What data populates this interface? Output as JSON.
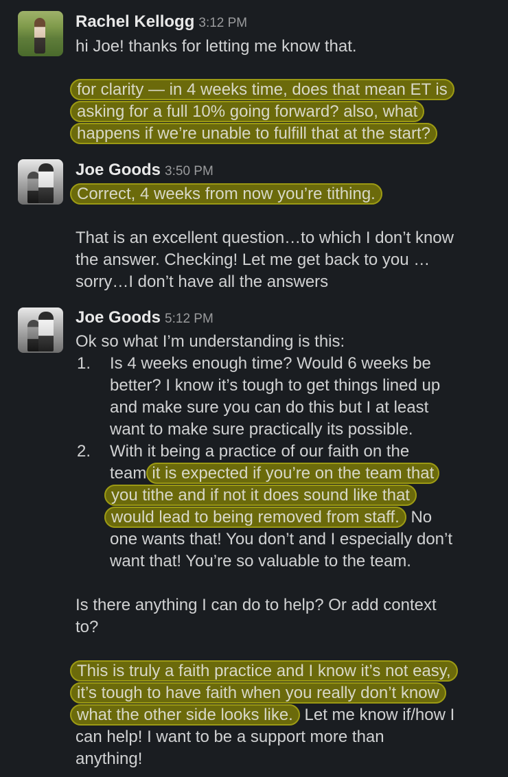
{
  "messages": [
    {
      "sender": "Rachel Kellogg",
      "time": "3:12 PM",
      "line1": "hi Joe! thanks for letting me know that.",
      "hl1": "for clarity — in 4 weeks time, does that mean ET is",
      "hl2": "asking for a full 10% going forward? also, what",
      "hl3": "happens if we’re unable to fulfill that at the start?"
    },
    {
      "sender": "Joe Goods",
      "time": "3:50 PM",
      "hl1": "Correct, 4 weeks from now you’re tithing.",
      "line1": "That is an excellent question…to which I don’t know",
      "line2": "the answer. Checking! Let me get back to you …",
      "line3": "sorry…I don’t have all the answers"
    },
    {
      "sender": "Joe Goods",
      "time": "5:12 PM",
      "intro": "Ok so what I’m understanding is this:",
      "item1": {
        "num": "1.",
        "l1": "Is 4 weeks enough time? Would 6 weeks be",
        "l2": "better? I know it’s tough to get things lined up",
        "l3": "and make sure you can do this but I at least",
        "l4": "want to make sure practically its possible."
      },
      "item2": {
        "num": "2.",
        "l1": "With it being a practice of our faith on the",
        "l2a": "team",
        "l2hl": "it is expected if you’re on the team that",
        "l3hl": "you tithe and if not it does sound like that",
        "l4hl": "would lead to being removed from staff.",
        "l4b": " No",
        "l5": "one wants that! You don’t and I especially don’t",
        "l6": "want that! You’re so valuable to the team."
      },
      "p2l1": "Is there anything I can do to help? Or add context",
      "p2l2": "to?",
      "p3hl1": "This is truly a faith practice and I know it’s not easy,",
      "p3hl2": "it’s tough to have faith when you really don’t know",
      "p3hl3": "what the other side looks like.",
      "p3l3b": " Let me know if/how I",
      "p3l4": "can help! I want to be a support more than",
      "p3l5": "anything!"
    }
  ],
  "colors": {
    "background": "#1a1d21",
    "text": "#d1d2d3",
    "highlight": "#6b6a0b",
    "highlight_border": "#9c9a14"
  }
}
